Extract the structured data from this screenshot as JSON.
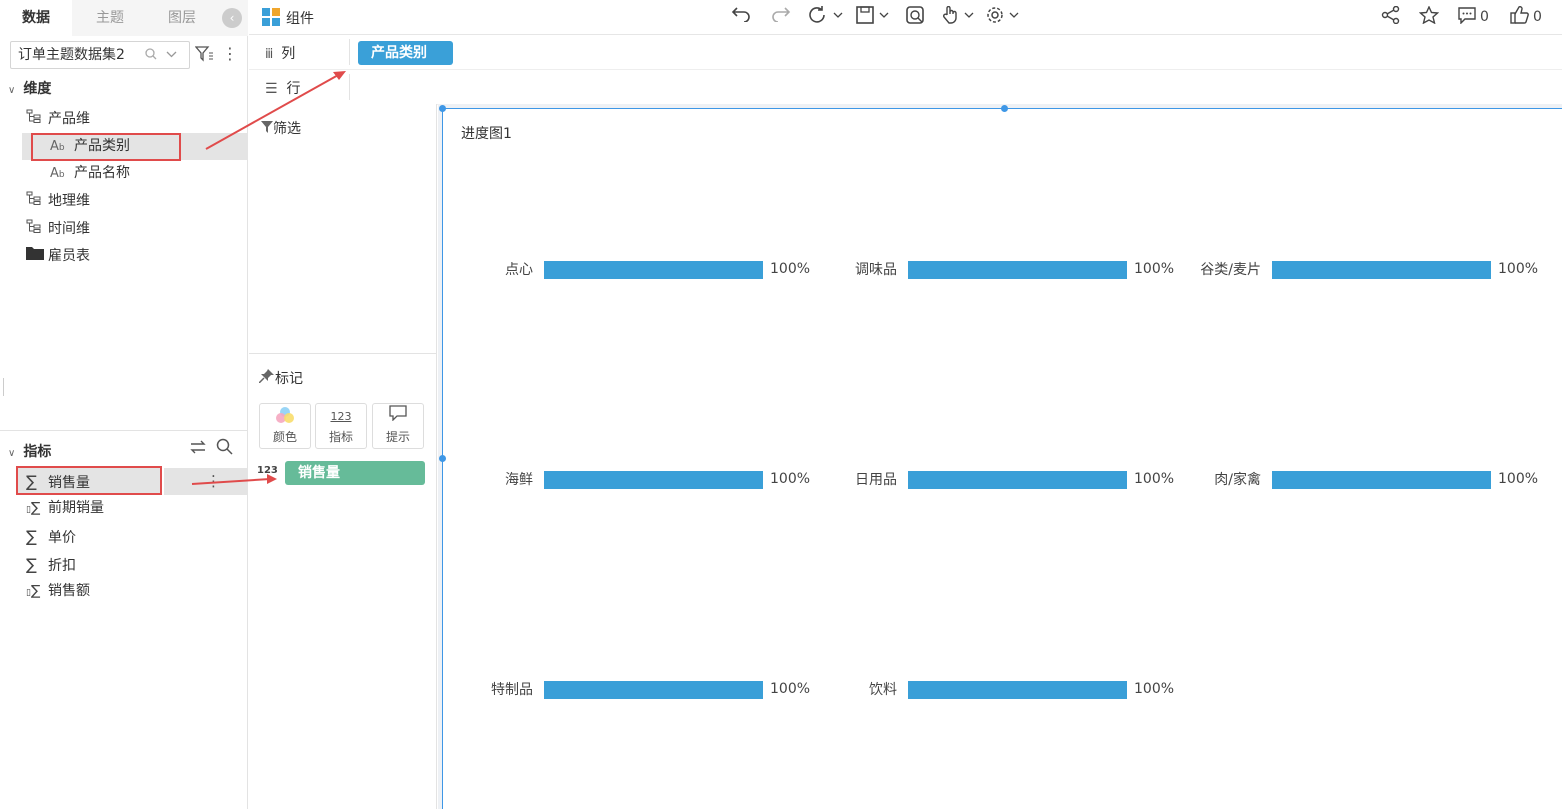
{
  "left_panel": {
    "tabs": [
      "数据",
      "主题",
      "图层"
    ],
    "active_tab": 0,
    "dataset": "订单主题数据集2",
    "dimension_header": "维度",
    "dimensions": [
      {
        "label": "产品维",
        "icon": "hierarchy-icon",
        "level": 0
      },
      {
        "label": "产品类别",
        "icon": "text-field-icon",
        "level": 1,
        "selected": true
      },
      {
        "label": "产品名称",
        "icon": "text-field-icon",
        "level": 1
      },
      {
        "label": "地理维",
        "icon": "hierarchy-icon",
        "level": 0
      },
      {
        "label": "时间维",
        "icon": "hierarchy-icon",
        "level": 0
      },
      {
        "label": "雇员表",
        "icon": "folder-icon",
        "level": 0
      }
    ],
    "measure_header": "指标",
    "measures": [
      {
        "label": "销售量",
        "icon": "sigma-icon",
        "selected": true
      },
      {
        "label": "前期销量",
        "icon": "calc-sigma-icon"
      },
      {
        "label": "单价",
        "icon": "sigma-icon"
      },
      {
        "label": "折扣",
        "icon": "sigma-icon"
      },
      {
        "label": "销售额",
        "icon": "calc-sigma-icon"
      }
    ]
  },
  "toolbar": {
    "components_label": "组件",
    "comment_count": "0",
    "like_count": "0"
  },
  "shelves": {
    "columns_label": "列",
    "rows_label": "行",
    "column_pill": "产品类别"
  },
  "filter_panel": {
    "title": "筛选"
  },
  "marks_panel": {
    "title": "标记",
    "buttons": [
      "颜色",
      "指标",
      "提示"
    ],
    "measure_tag": "123",
    "measure_pill": "销售量"
  },
  "colors": {
    "accent": "#3a9fd8",
    "pill_blue": "#3aa0d8",
    "pill_green": "#66bb99",
    "highlight_red": "#e04b4b",
    "selection_blue": "#3e97e6"
  },
  "chart_data": {
    "type": "progress",
    "title": "进度图1",
    "categories": [
      "点心",
      "调味品",
      "谷类/麦片",
      "海鲜",
      "日用品",
      "肉/家禽",
      "特制品",
      "饮料"
    ],
    "values": [
      1.0,
      1.0,
      1.0,
      1.0,
      1.0,
      1.0,
      1.0,
      1.0
    ],
    "value_labels": [
      "100%",
      "100%",
      "100%",
      "100%",
      "100%",
      "100%",
      "100%",
      "100%"
    ],
    "grid_columns": 3
  }
}
